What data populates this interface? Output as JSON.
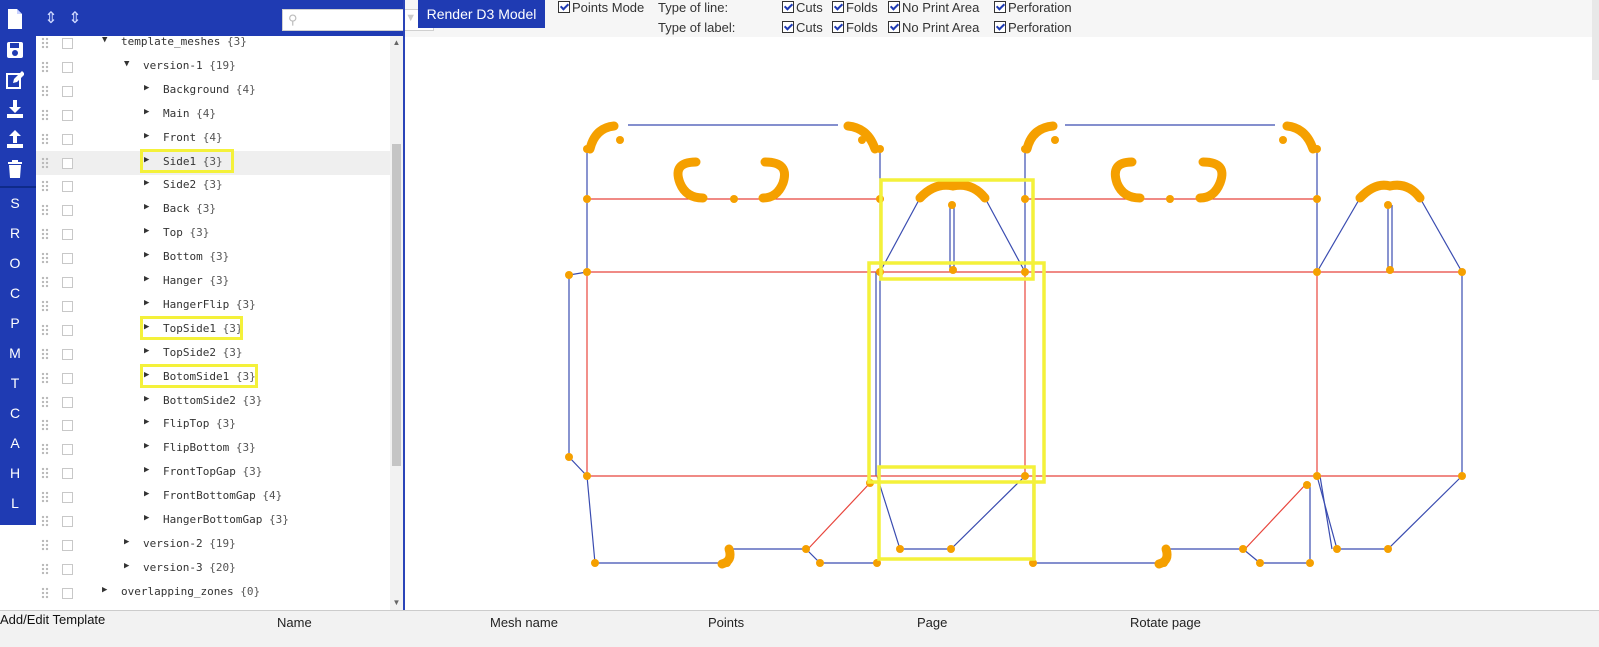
{
  "tree": {
    "search_placeholder": "",
    "rows": [
      {
        "name": "template_meshes",
        "count": "{3}"
      },
      {
        "name": "version-1",
        "count": "{19}"
      },
      {
        "name": "Background",
        "count": "{4}"
      },
      {
        "name": "Main",
        "count": "{4}"
      },
      {
        "name": "Front",
        "count": "{4}"
      },
      {
        "name": "Side1",
        "count": "{3}"
      },
      {
        "name": "Side2",
        "count": "{3}"
      },
      {
        "name": "Back",
        "count": "{3}"
      },
      {
        "name": "Top",
        "count": "{3}"
      },
      {
        "name": "Bottom",
        "count": "{3}"
      },
      {
        "name": "Hanger",
        "count": "{3}"
      },
      {
        "name": "HangerFlip",
        "count": "{3}"
      },
      {
        "name": "TopSide1",
        "count": "{3}"
      },
      {
        "name": "TopSide2",
        "count": "{3}"
      },
      {
        "name": "BotomSide1",
        "count": "{3}"
      },
      {
        "name": "BottomSide2",
        "count": "{3}"
      },
      {
        "name": "FlipTop",
        "count": "{3}"
      },
      {
        "name": "FlipBottom",
        "count": "{3}"
      },
      {
        "name": "FrontTopGap",
        "count": "{3}"
      },
      {
        "name": "FrontBottomGap",
        "count": "{4}"
      },
      {
        "name": "HangerBottomGap",
        "count": "{3}"
      },
      {
        "name": "version-2",
        "count": "{19}"
      },
      {
        "name": "version-3",
        "count": "{20}"
      },
      {
        "name": "overlapping_zones",
        "count": "{0}"
      }
    ]
  },
  "rail": {
    "icons": [
      "file-icon",
      "save-icon",
      "edit-icon",
      "download-icon",
      "upload-icon",
      "trash-icon"
    ],
    "letters": [
      "S",
      "R",
      "O",
      "C",
      "P",
      "M",
      "T",
      "C",
      "A",
      "H",
      "L"
    ]
  },
  "toolbar": {
    "render_button": "Render D3 Model",
    "points_mode": "Points Mode",
    "type_of_line": "Type of line:",
    "type_of_label": "Type of label:",
    "cuts": "Cuts",
    "folds": "Folds",
    "no_print_area": "No Print Area",
    "perforation": "Perforation"
  },
  "bottom": {
    "add_edit_template": "Add/Edit Template",
    "columns": [
      "Name",
      "Mesh name",
      "Points",
      "Page",
      "Rotate page"
    ]
  },
  "colors": {
    "accent": "#1f3bb3",
    "cut_line": "#3a4cb0",
    "fold_line": "#e8453c",
    "point": "#f5a000",
    "highlight": "#f4f13a"
  }
}
